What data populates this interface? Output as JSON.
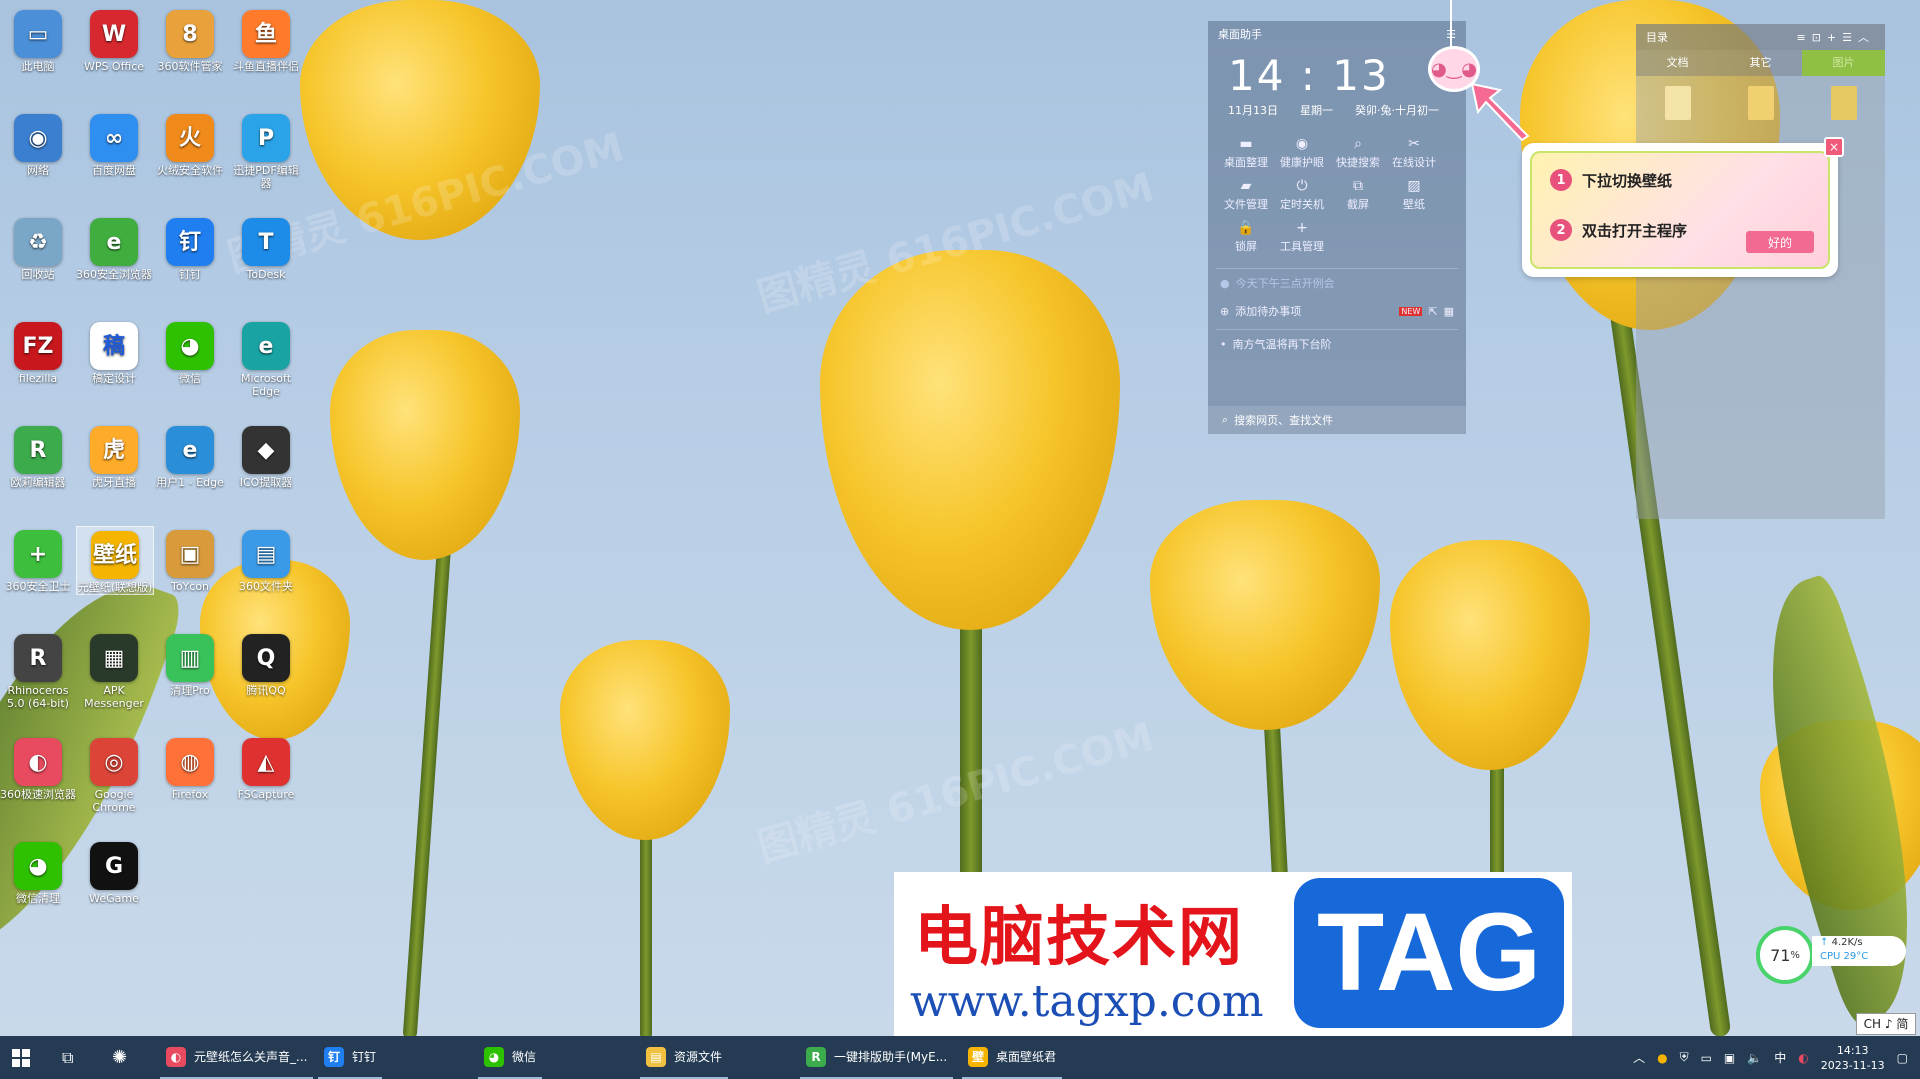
{
  "desktop_icons": [
    {
      "label": "此电脑",
      "glyph": "▭",
      "color": "#4a8fd8"
    },
    {
      "label": "WPS Office",
      "glyph": "W",
      "color": "#d7282f"
    },
    {
      "label": "360软件管家",
      "glyph": "8",
      "color": "#e9a23b"
    },
    {
      "label": "斗鱼直播伴侣",
      "glyph": "鱼",
      "color": "#ff7a2a"
    },
    {
      "label": "网络",
      "glyph": "◉",
      "color": "#3a7fd0"
    },
    {
      "label": "百度网盘",
      "glyph": "∞",
      "color": "#2f8ff0"
    },
    {
      "label": "火绒安全软件",
      "glyph": "火",
      "color": "#f08a1a"
    },
    {
      "label": "迅捷PDF编辑器",
      "glyph": "P",
      "color": "#2aa3e8"
    },
    {
      "label": "回收站",
      "glyph": "♻",
      "color": "#7aa6c8"
    },
    {
      "label": "360安全浏览器",
      "glyph": "e",
      "color": "#3fae3f"
    },
    {
      "label": "钉钉",
      "glyph": "钉",
      "color": "#1f7ef0"
    },
    {
      "label": "ToDesk",
      "glyph": "T",
      "color": "#1c8ce8"
    },
    {
      "label": "filezilla",
      "glyph": "FZ",
      "color": "#c8171d"
    },
    {
      "label": "稿定设计",
      "glyph": "稿",
      "color": "#ffffff"
    },
    {
      "label": "微信",
      "glyph": "◕",
      "color": "#2dc100"
    },
    {
      "label": "Microsoft Edge",
      "glyph": "e",
      "color": "#1aa3a3"
    },
    {
      "label": "欧莉编辑器",
      "glyph": "R",
      "color": "#3cab4c"
    },
    {
      "label": "虎牙直播",
      "glyph": "虎",
      "color": "#ffab2a"
    },
    {
      "label": "用户1 - Edge",
      "glyph": "e",
      "color": "#2b8ed8"
    },
    {
      "label": "ICO提取器",
      "glyph": "◆",
      "color": "#333333"
    },
    {
      "label": "360安全卫士",
      "glyph": "+",
      "color": "#3dbf3d"
    },
    {
      "label": "元壁纸(联想版)",
      "glyph": "壁纸",
      "color": "#f4b400"
    },
    {
      "label": "ToYcon",
      "glyph": "▣",
      "color": "#d89a3a"
    },
    {
      "label": "360文件夹",
      "glyph": "▤",
      "color": "#3a9ae8"
    },
    {
      "label": "Rhinoceros 5.0 (64-bit)",
      "glyph": "R",
      "color": "#444444"
    },
    {
      "label": "APK Messenger",
      "glyph": "▦",
      "color": "#2a3a2a"
    },
    {
      "label": "清理Pro",
      "glyph": "▥",
      "color": "#3ac25a"
    },
    {
      "label": "腾讯QQ",
      "glyph": "Q",
      "color": "#222222"
    },
    {
      "label": "360极速浏览器",
      "glyph": "◐",
      "color": "#e84a5f"
    },
    {
      "label": "Google Chrome",
      "glyph": "◎",
      "color": "#db4437"
    },
    {
      "label": "Firefox",
      "glyph": "◍",
      "color": "#ff7139"
    },
    {
      "label": "FSCapture",
      "glyph": "◭",
      "color": "#e03131"
    },
    {
      "label": "微信清理",
      "glyph": "◕",
      "color": "#2dc100"
    },
    {
      "label": "WeGame",
      "glyph": "G",
      "color": "#111111"
    }
  ],
  "helper": {
    "title": "桌面助手",
    "time": "14 : 13",
    "date": "11月13日",
    "weekday": "星期一",
    "lunar": "癸卯·兔·十月初一",
    "tools": [
      "桌面整理",
      "健康护眼",
      "快捷搜索",
      "在线设计",
      "文件管理",
      "定时关机",
      "截屏",
      "壁纸",
      "锁屏",
      "工具管理"
    ],
    "tool_icons": [
      "▬",
      "◉",
      "⌕",
      "✂",
      "▰",
      "⏻",
      "⧉",
      "▨",
      "🔒",
      "+"
    ],
    "todo_item": "今天下午三点开例会",
    "add_todo": "添加待办事项",
    "new_badge": "NEW",
    "weather_tip": "南方气温将再下台阶",
    "search_placeholder": "搜索网页、查找文件"
  },
  "catalog": {
    "title": "目录",
    "tabs": [
      "文档",
      "其它",
      "图片"
    ]
  },
  "tip": {
    "item1": "下拉切换壁纸",
    "item2": "双击打开主程序",
    "num1": "1",
    "num2": "2",
    "ok": "好的",
    "close": "×"
  },
  "banner": {
    "cn": "电脑技术网",
    "url": "www.tagxp.com",
    "tag": "TAG"
  },
  "sysmon": {
    "cpu_percent": "71",
    "percent_sign": "%",
    "net_speed": "4.2K/s",
    "cpu_temp": "CPU 29°C"
  },
  "ime": "CH ♪ 简",
  "taskbar": {
    "items": [
      {
        "label": "元壁纸怎么关声音_...",
        "color": "#e84a5f",
        "glyph": "◐"
      },
      {
        "label": "钉钉",
        "color": "#1f7ef0",
        "glyph": "钉"
      },
      {
        "label": "微信",
        "color": "#2dc100",
        "glyph": "◕"
      },
      {
        "label": "资源文件",
        "color": "#f0c040",
        "glyph": "▤"
      },
      {
        "label": "一键排版助手(MyE...",
        "color": "#3cab4c",
        "glyph": "R"
      },
      {
        "label": "桌面壁纸君",
        "color": "#f4b400",
        "glyph": "壁"
      }
    ],
    "tray_lang": "中",
    "time": "14:13",
    "date": "2023-11-13"
  },
  "watermarks": [
    "图精灵 616PIC.COM",
    "图精灵 616PIC.COM",
    "图精灵 616PIC.COM"
  ]
}
